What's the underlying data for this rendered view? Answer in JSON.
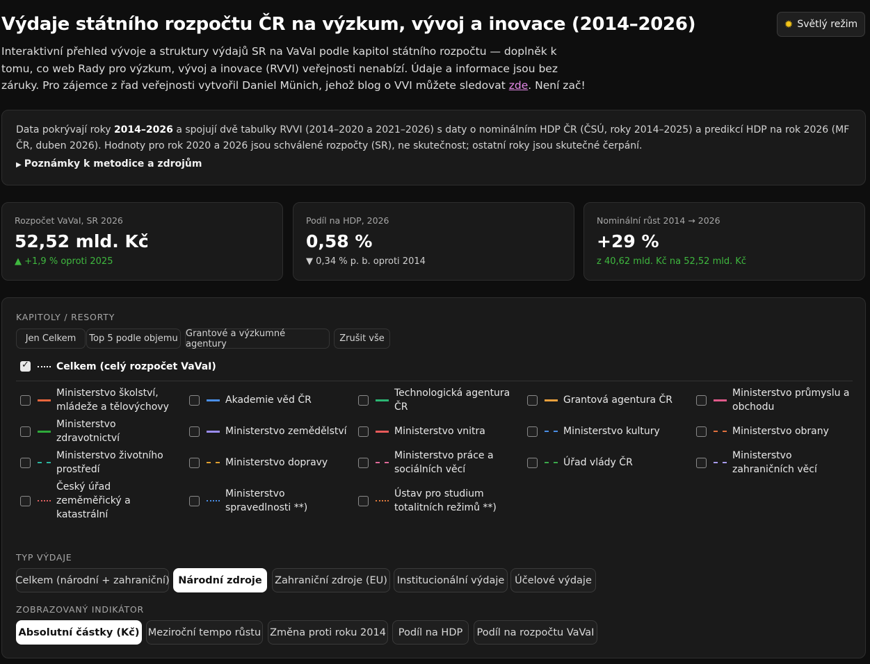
{
  "header": {
    "title": "Výdaje státního rozpočtu ČR na výzkum, vývoj a inovace (2014–2026)",
    "theme_button": "Světlý režim",
    "theme_icon": "sun-icon",
    "intro_before_link": "Interaktivní přehled vývoje a struktury výdajů SR na VaVaI podle kapitol státního rozpočtu — doplněk k tomu, co web Rady pro výzkum, vývoj a inovace (RVVI) veřejnosti nenabízí. Údaje a informace jsou bez záruky. Pro zájemce z řad veřejnosti vytvořil Daniel Münich, jehož blog o VVI můžete sledovat ",
    "intro_link": "zde",
    "intro_after_link": ". Není zač!"
  },
  "note": {
    "text_before": "Data pokrývají roky ",
    "years": "2014–2026",
    "text_after": " a spojují dvě tabulky RVVI (2014–2020 a 2021–2026) s daty o nominálním HDP ČR (ČSÚ, roky 2014–2025) a predikcí HDP na rok 2026 (MF ČR, duben 2026). Hodnoty pro rok 2020 a 2026 jsou schválené rozpočty (SR), ne skutečnost; ostatní roky jsou skutečné čerpání.",
    "details_label": "Poznámky k metodice a zdrojům"
  },
  "kpis": [
    {
      "label": "Rozpočet VaVaI, SR 2026",
      "value": "52,52 mld. Kč",
      "arrow": "▲",
      "note": "+1,9 % oproti 2025"
    },
    {
      "label": "Podíl na HDP, 2026",
      "value": "0,58 %",
      "arrow": "▼",
      "note": "0,34 % p. b. oproti 2014"
    },
    {
      "label": "Nominální růst 2014 → 2026",
      "value": "+29 %",
      "arrow": "",
      "note": "z 40,62 mld. Kč na 52,52 mld. Kč"
    }
  ],
  "colors": {
    "up": "#3fb83f",
    "series": [
      "#e8663d",
      "#4a8fe7",
      "#2bb673",
      "#e8a03d",
      "#e05a8a",
      "#2eaa3a",
      "#9a8cf0",
      "#e85a5a",
      "#4a8fe7",
      "#e0703d",
      "#2bb6a0",
      "#e0a030",
      "#e06a9a",
      "#3aa84a",
      "#a89cf0",
      "#e06060",
      "#4a8fe7",
      "#e07a3d"
    ]
  },
  "chapters": {
    "section_label": "Kapitoly / resorty",
    "quick_buttons": [
      "Jen Celkem",
      "Top 5 podle objemu",
      "Grantové a výzkumné agentury",
      "Zrušit vše"
    ],
    "total_label": "Celkem (celý rozpočet VaVaI)",
    "items": [
      "Ministerstvo školství, mládeže a tělovýchovy",
      "Akademie věd ČR",
      "Technologická agentura ČR",
      "Grantová agentura ČR",
      "Ministerstvo průmyslu a obchodu",
      "Ministerstvo zdravotnictví",
      "Ministerstvo zemědělství",
      "Ministerstvo vnitra",
      "Ministerstvo kultury",
      "Ministerstvo obrany",
      "Ministerstvo životního prostředí",
      "Ministerstvo dopravy",
      "Ministerstvo práce a sociálních věcí",
      "Úřad vlády ČR",
      "Ministerstvo zahraničních věcí",
      "Český úřad zeměměřický a katastrální",
      "Ministerstvo spravedlnosti **)",
      "Ústav pro studium totalitních režimů **)"
    ]
  },
  "expense_type": {
    "section_label": "Typ výdaje",
    "options": [
      "Celkem (národní + zahraniční)",
      "Národní zdroje",
      "Zahraniční zdroje (EU)",
      "Institucionální výdaje",
      "Účelové výdaje"
    ],
    "selected": "Národní zdroje"
  },
  "indicator": {
    "section_label": "Zobrazovaný indikátor",
    "options": [
      "Absolutní částky (Kč)",
      "Meziroční tempo růstu",
      "Změna proti roku 2014",
      "Podíl na HDP",
      "Podíl na rozpočtu VaVaI"
    ],
    "selected": "Absolutní částky (Kč)"
  }
}
